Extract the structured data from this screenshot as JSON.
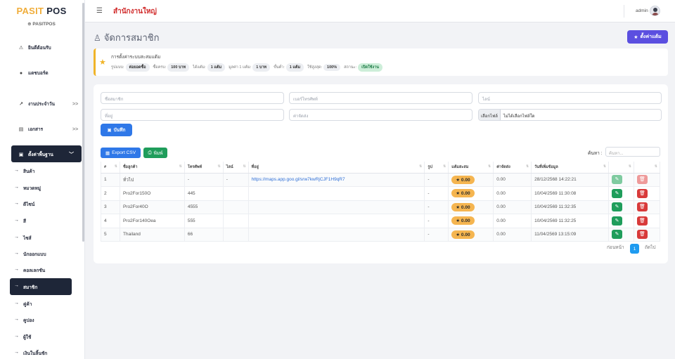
{
  "brand": {
    "part1": "PASIT",
    "part2": "POS",
    "sub": "⊕ PASITPOS"
  },
  "sidebar": {
    "items": [
      {
        "label": "ยินดีต้อนรับ",
        "icon": "dashboard-icon"
      },
      {
        "label": "แดชบอร์ด",
        "icon": "info-icon"
      },
      {
        "label": "งานประจำวัน",
        "icon": "chart-line-icon",
        "chevron": ">>"
      },
      {
        "label": "เอกสาร",
        "icon": "document-icon",
        "chevron": ">>"
      },
      {
        "label": "ตั้งค่าพื้นฐาน",
        "icon": "printer-icon",
        "chevron": "﹀"
      }
    ],
    "subitems": [
      "สินค้า",
      "หมวดหมู่",
      "ดีไซน์",
      "สี",
      "ไซส์",
      "นักออกแบบ",
      "คอลเลกชัน",
      "สมาชิก",
      "คู่ค้า",
      "คูปอง",
      "ผู้ใช้",
      "เงินในลิ้นชัก"
    ],
    "active_sub": "สมาชิก"
  },
  "topbar": {
    "branch": "สำนักงานใหญ่",
    "user": "admin"
  },
  "page": {
    "title": "จัดการสมาชิก",
    "settings_button": "ตั้งค่าแต้ม"
  },
  "points": {
    "title": "การตั้งค่าระบบสะสมแต้ม",
    "fields": [
      {
        "label": "รูปแบบ:",
        "value": "ต่อยอดซื้อ"
      },
      {
        "label": "ซื้อครบ:",
        "value": "100 บาท"
      },
      {
        "label": "ได้แต้ม:",
        "value": "1 แต้ม"
      },
      {
        "label": "มูลค่า 1 แต้ม:",
        "value": "1 บาท"
      },
      {
        "label": "ขั้นต่ำ:",
        "value": "1 แต้ม"
      },
      {
        "label": "ใช้สูงสุด:",
        "value": "100%"
      },
      {
        "label": "สถานะ:",
        "value": "เปิดใช้งาน",
        "status": true
      }
    ]
  },
  "form": {
    "name_ph": "ชื่อสมาชิก",
    "phone_ph": "เบอร์โทรศัพท์",
    "line_ph": "ไลน์",
    "address_ph": "ที่อยู่",
    "shipping_ph": "ค่าจัดส่ง",
    "file_button": "เลือกไฟล์",
    "file_text": "ไม่ได้เลือกไฟล์ใด",
    "save_button": "บันทึก"
  },
  "toolbar": {
    "csv": "Export CSV",
    "print": "พิมพ์",
    "search_label": "ค้นหา :",
    "search_ph": "ค้นหา..."
  },
  "table": {
    "headers": [
      "#",
      "ชื่อลูกค้า",
      "โทรศัพท์",
      "ไลน์",
      "ที่อยู่",
      "รูป",
      "แต้มสะสม",
      "ค่าจัดส่ง",
      "วันที่เพิ่มข้อมูล",
      "",
      ""
    ],
    "rows": [
      {
        "no": "1",
        "name": "ทั่วไป",
        "phone": "-",
        "line": "-",
        "address": "https://maps.app.goo.gl/srw7kwRjCJF1H9qR7",
        "img": "-",
        "points": "★ 0.00",
        "shipping": "0.00",
        "date": "28/12/2568 14:22:21"
      },
      {
        "no": "2",
        "name": "Pro2For150O",
        "phone": "445",
        "line": "",
        "address": "",
        "img": "-",
        "points": "★ 0.00",
        "shipping": "0.00",
        "date": "10/04/2569 11:30:08"
      },
      {
        "no": "3",
        "name": "Pro2For40O",
        "phone": "4555",
        "line": "",
        "address": "",
        "img": "-",
        "points": "★ 0.00",
        "shipping": "0.00",
        "date": "10/04/2569 11:32:35"
      },
      {
        "no": "4",
        "name": "Pro2For140Oea",
        "phone": "555",
        "line": "",
        "address": "",
        "img": "-",
        "points": "★ 0.00",
        "shipping": "0.00",
        "date": "10/04/2569 11:32:25"
      },
      {
        "no": "5",
        "name": "Thailand",
        "phone": "66",
        "line": "",
        "address": "",
        "img": "-",
        "points": "★ 0.00",
        "shipping": "0.00",
        "date": "11/04/2569 13:15:09"
      }
    ]
  },
  "pagination": {
    "prev": "ก่อนหน้า",
    "page": "1",
    "next": "ถัดไป"
  },
  "colors": {
    "accent": "#5b4fe0",
    "brand_gold": "#f0ad3a",
    "nav_dark": "#1e2638",
    "primary": "#2f78e8",
    "success": "#1f9d5b",
    "danger": "#d83a3a",
    "branch_red": "#d12d2d"
  }
}
